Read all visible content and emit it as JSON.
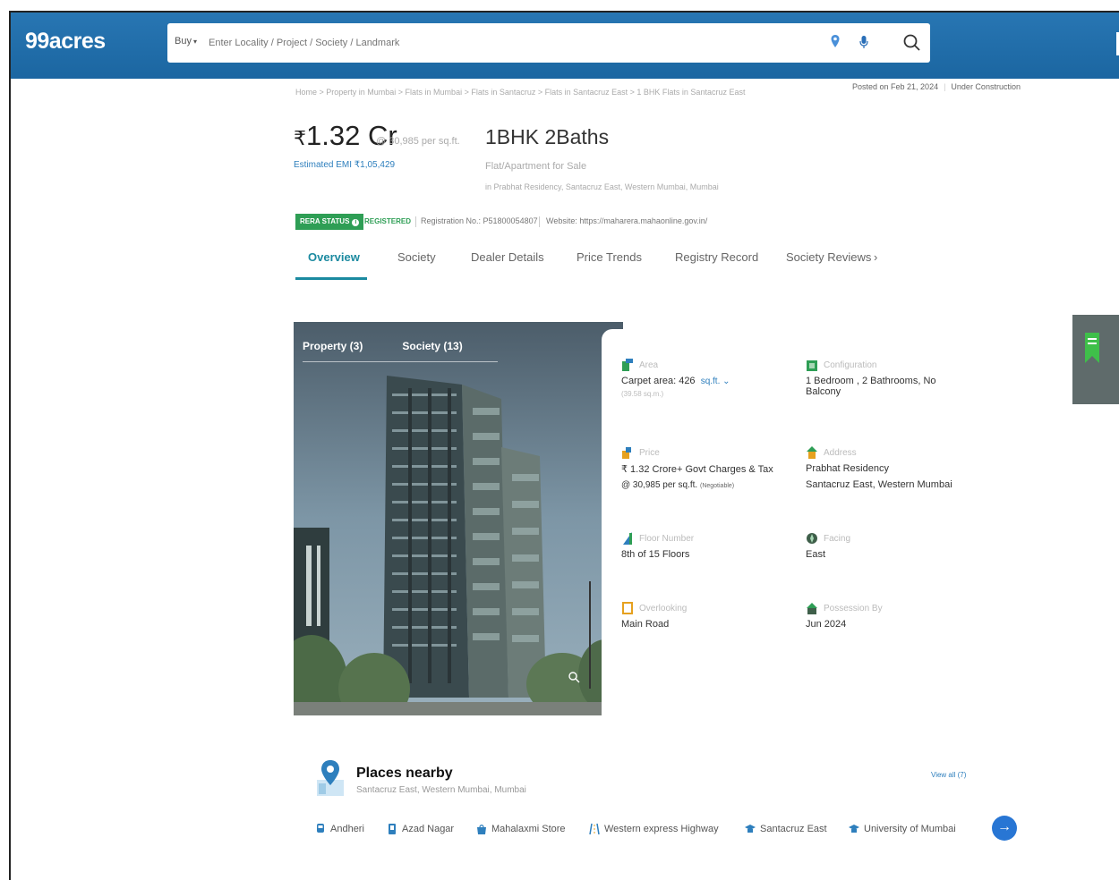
{
  "header": {
    "logo": "99acres",
    "buy_label": "Buy",
    "search_placeholder": "Enter Locality / Project / Society / Landmark"
  },
  "breadcrumb": "Home > Property in Mumbai > Flats in Mumbai > Flats in Santacruz > Flats in Santacruz East > 1 BHK Flats in Santacruz East",
  "posted": {
    "date": "Posted on Feb 21, 2024",
    "status": "Under Construction"
  },
  "listing": {
    "price": "1.32 Cr",
    "currency_symbol": "₹",
    "price_per_sqft": "@ 30,985 per sq.ft.",
    "emi": "Estimated EMI ₹1,05,429",
    "title": "1BHK 2Baths",
    "type": "Flat/Apartment for Sale",
    "address": "in Prabhat Residency, Santacruz East, Western Mumbai, Mumbai"
  },
  "rera": {
    "status_label": "RERA STATUS",
    "registered": "REGISTERED",
    "registration_no": "Registration No.: P51800054807",
    "website": "Website: https://maharera.mahaonline.gov.in/"
  },
  "tabs": [
    "Overview",
    "Society",
    "Dealer Details",
    "Price Trends",
    "Registry Record",
    "Society Reviews"
  ],
  "gallery": {
    "tab_property": "Property (3)",
    "tab_society": "Society (13)"
  },
  "details": {
    "area": {
      "label": "Area",
      "value": "Carpet area: 426",
      "unit": "sq.ft.",
      "sub": "(39.58 sq.m.)"
    },
    "configuration": {
      "label": "Configuration",
      "value": "1 Bedroom , 2 Bathrooms, No Balcony"
    },
    "price": {
      "label": "Price",
      "value": "₹ 1.32 Crore+ Govt Charges & Tax",
      "sub": "@ 30,985 per sq.ft.",
      "neg": "(Negotiable)"
    },
    "address": {
      "label": "Address",
      "value": "Prabhat Residency",
      "sub": "Santacruz East, Western Mumbai"
    },
    "floor": {
      "label": "Floor Number",
      "value": "8th of 15 Floors"
    },
    "facing": {
      "label": "Facing",
      "value": "East"
    },
    "overlooking": {
      "label": "Overlooking",
      "value": "Main Road"
    },
    "possession": {
      "label": "Possession By",
      "value": "Jun 2024"
    }
  },
  "places": {
    "title": "Places nearby",
    "subtitle": "Santacruz East, Western Mumbai, Mumbai",
    "view_all": "View all (7)",
    "items": [
      "Andheri",
      "Azad Nagar",
      "Mahalaxmi Store",
      "Western express Highway",
      "Santacruz East",
      "University of Mumbai"
    ]
  },
  "colors": {
    "header_blue": "#2876b3",
    "teal_accent": "#1b8aa0",
    "rera_green": "#2e9e55",
    "link_blue": "#2e7fbd"
  }
}
